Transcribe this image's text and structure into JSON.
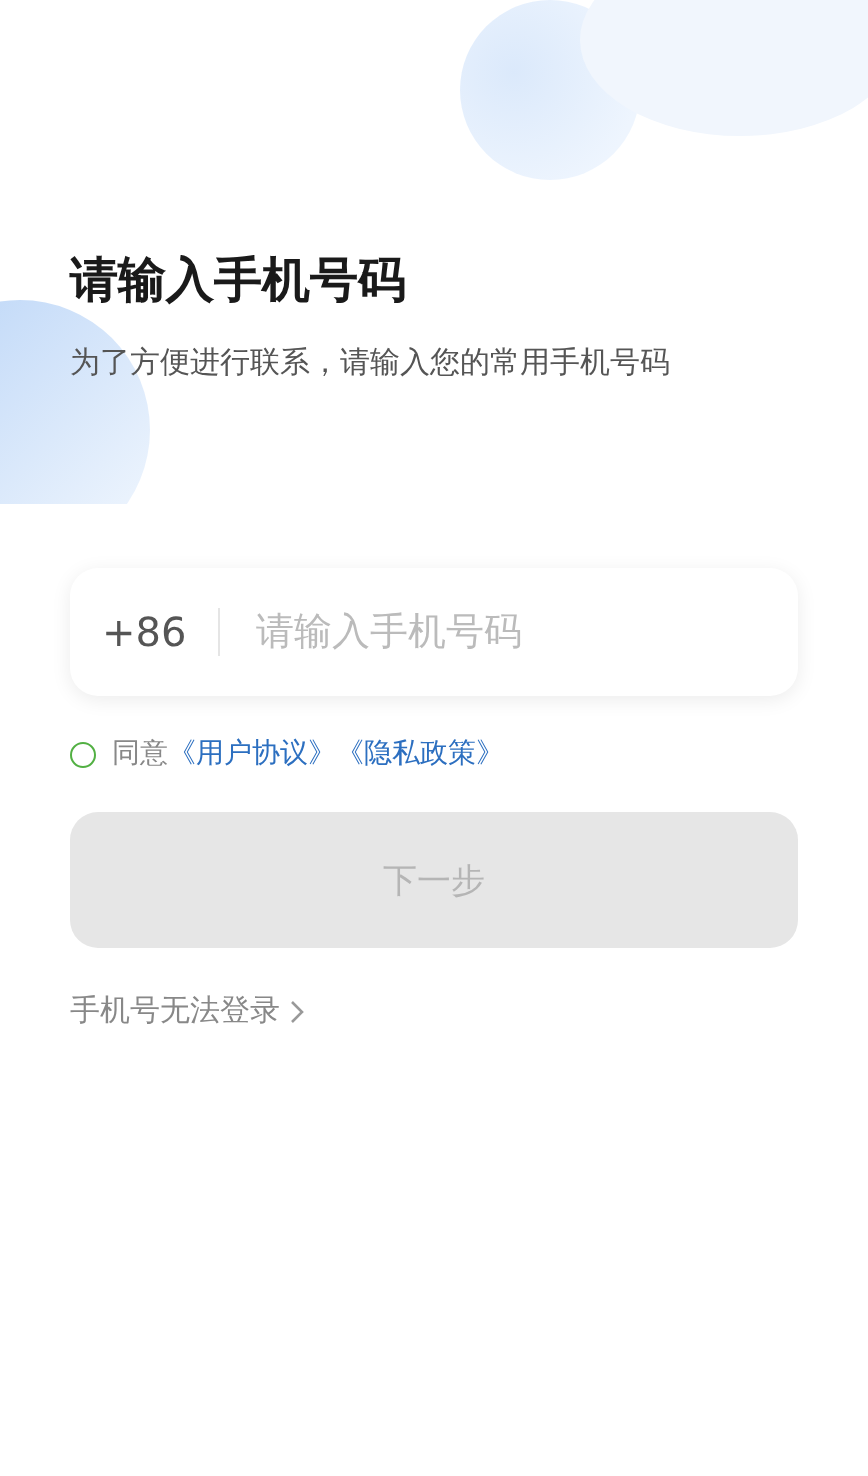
{
  "title": "请输入手机号码",
  "subtitle": "为了方便进行联系，请输入您的常用手机号码",
  "phone_field": {
    "country_code": "+86",
    "placeholder": "请输入手机号码"
  },
  "agreement": {
    "checked": false,
    "prefix": "同意",
    "links": [
      "《用户协议》",
      "《隐私政策》"
    ]
  },
  "next_button": {
    "label": "下一步",
    "disabled": true
  },
  "help_link": {
    "label": "手机号无法登录"
  }
}
